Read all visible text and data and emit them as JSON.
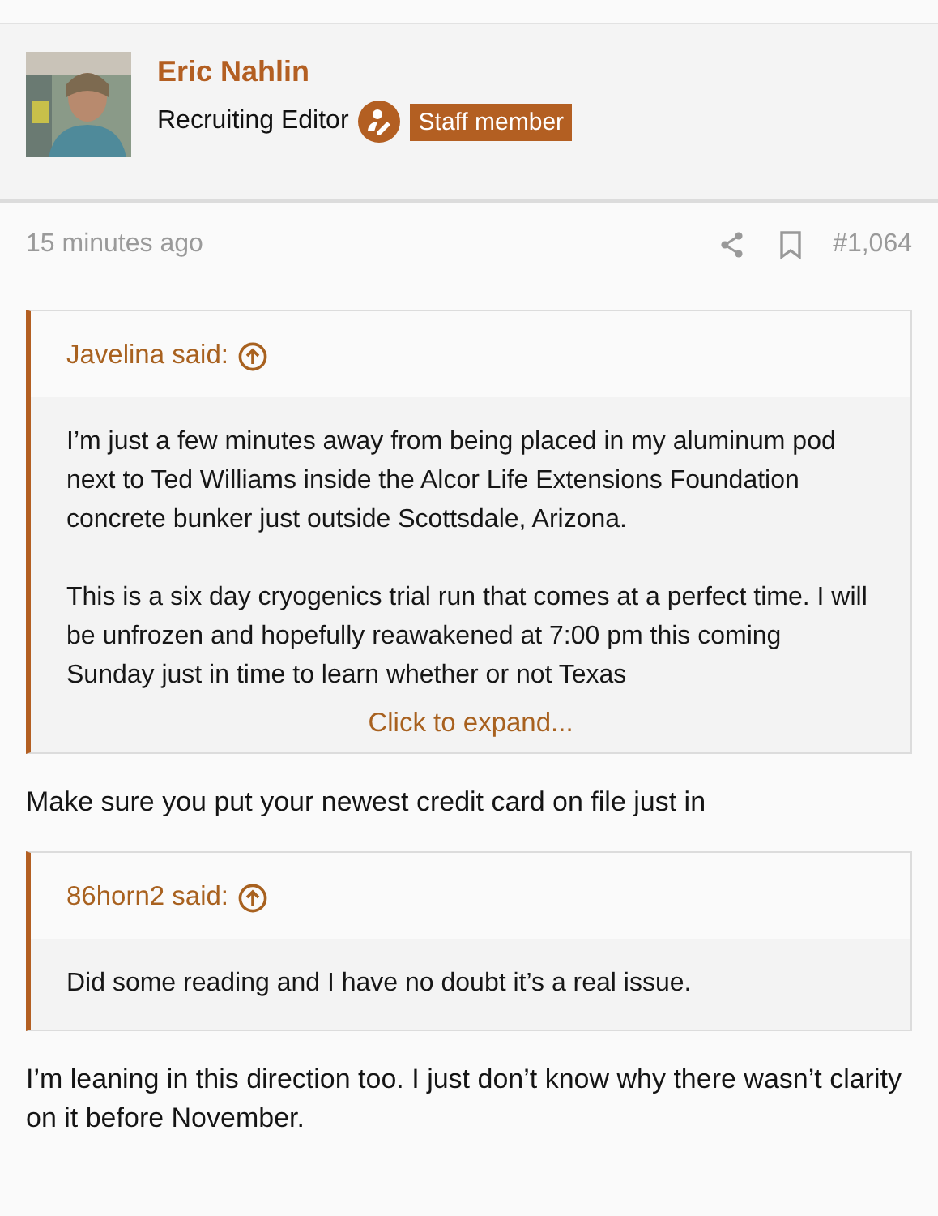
{
  "author": {
    "name": "Eric Nahlin",
    "role": "Recruiting Editor",
    "badge": "Staff member"
  },
  "post": {
    "time": "15 minutes ago",
    "number": "#1,064",
    "blocks": [
      {
        "kind": "quote",
        "author": "Javelina said:",
        "paragraphs": [
          "I’m just a few minutes away from being placed in my aluminum pod next to Ted Williams inside the Alcor Life Extensions Foundation concrete bunker just outside Scottsdale, Arizona.",
          "This is a six day cryogenics trial run that comes at a perfect time. I will be unfrozen and hopefully reawakened at 7:00 pm this coming Sunday just in time to learn whether or not Texas"
        ],
        "expand": "Click to expand..."
      },
      {
        "kind": "text",
        "text": "Make sure you put your newest credit card on file just in"
      },
      {
        "kind": "quote",
        "author": "86horn2 said:",
        "paragraphs": [
          "Did some reading and I have no doubt it’s a real issue."
        ]
      },
      {
        "kind": "text",
        "text": "I’m leaning in this direction too. I just don’t know why there wasn’t clarity on it before November."
      }
    ]
  }
}
